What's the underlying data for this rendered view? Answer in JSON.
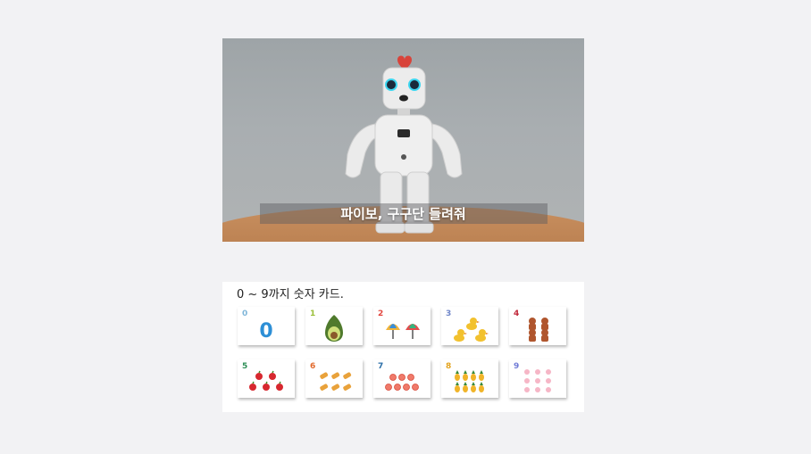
{
  "video": {
    "caption": "파이보, 구구단 들려줘"
  },
  "cards": {
    "title": "0 ~ 9까지 숫자 카드.",
    "items": [
      {
        "number": "0",
        "color": "#7fb6d9",
        "icon": "big-zero-icon"
      },
      {
        "number": "1",
        "color": "#9bbf3a",
        "icon": "avocado-icon"
      },
      {
        "number": "2",
        "color": "#e2463f",
        "icon": "umbrella-icon"
      },
      {
        "number": "3",
        "color": "#6f86c9",
        "icon": "duck-icon"
      },
      {
        "number": "4",
        "color": "#c0283a",
        "icon": "bear-icon"
      },
      {
        "number": "5",
        "color": "#2e8f57",
        "icon": "apple-icon"
      },
      {
        "number": "6",
        "color": "#e26a2c",
        "icon": "bread-icon"
      },
      {
        "number": "7",
        "color": "#2c6fa8",
        "icon": "peach-icon"
      },
      {
        "number": "8",
        "color": "#e3a31d",
        "icon": "pineapple-icon"
      },
      {
        "number": "9",
        "color": "#6f7ad6",
        "icon": "pig-icon"
      }
    ]
  }
}
